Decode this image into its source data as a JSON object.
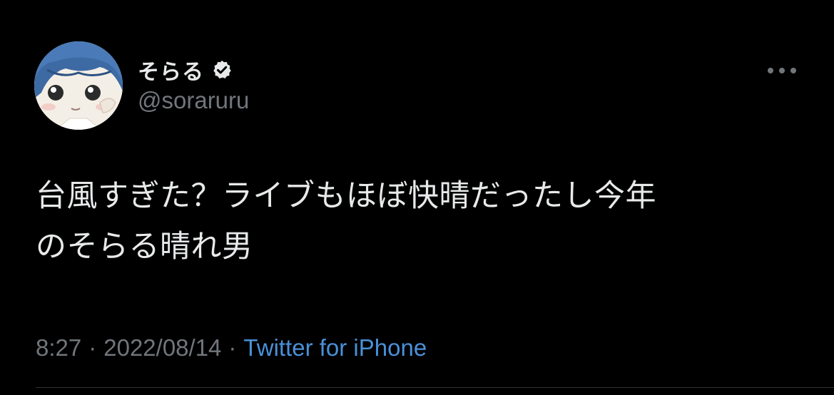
{
  "tweet": {
    "author": {
      "display_name": "そらる",
      "handle": "@soraruru",
      "verified": true
    },
    "text_line1": "台風すぎた？ライブもほぼ快晴だったし今年",
    "text_line2": "のそらる晴れ男",
    "time": "8:27",
    "separator": "·",
    "date": "2022/08/14",
    "source": "Twitter for iPhone"
  },
  "colors": {
    "background": "#000000",
    "primary_text": "#e7e9ea",
    "secondary_text": "#71767b",
    "link": "#4a90d9"
  },
  "icons": {
    "verified": "verified-badge-icon",
    "more": "more-options-icon"
  }
}
